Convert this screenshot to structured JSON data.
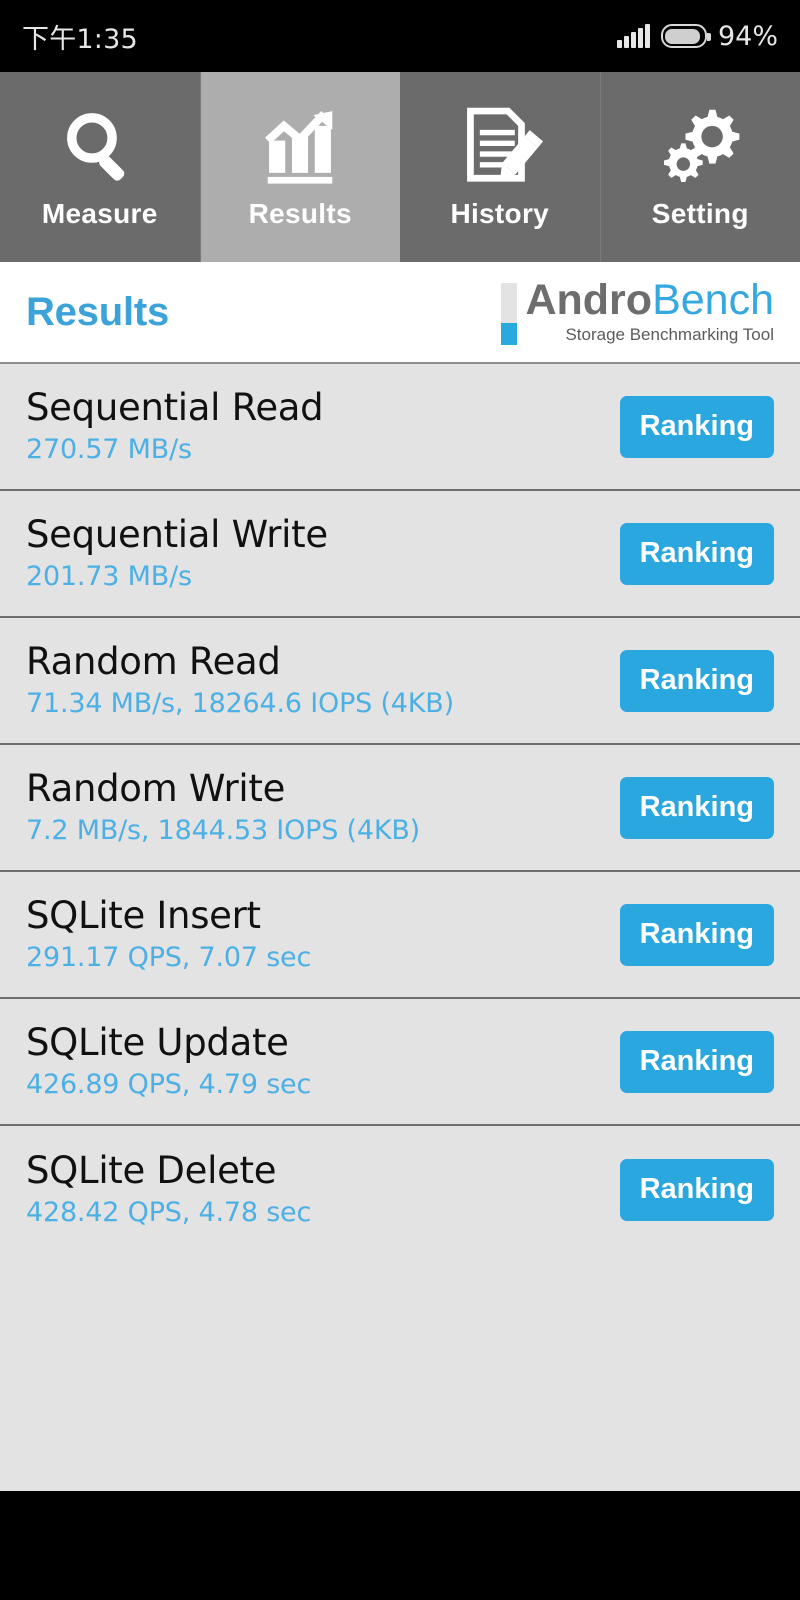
{
  "statusbar": {
    "time": "下午1:35",
    "battery_percent": "94%",
    "signal_icon": "signal-bars-icon",
    "battery_icon": "battery-icon"
  },
  "tabs": [
    {
      "label": "Measure",
      "icon": "magnifier-icon",
      "active": false
    },
    {
      "label": "Results",
      "icon": "bar-chart-arrow-icon",
      "active": true
    },
    {
      "label": "History",
      "icon": "document-pencil-icon",
      "active": false
    },
    {
      "label": "Setting",
      "icon": "gears-icon",
      "active": false
    }
  ],
  "header": {
    "title": "Results",
    "brand_first": "Andro",
    "brand_second": "Bench",
    "tagline": "Storage Benchmarking Tool"
  },
  "results": [
    {
      "title": "Sequential Read",
      "value": "270.57 MB/s",
      "button": "Ranking"
    },
    {
      "title": "Sequential Write",
      "value": "201.73 MB/s",
      "button": "Ranking"
    },
    {
      "title": "Random Read",
      "value": "71.34 MB/s, 18264.6 IOPS (4KB)",
      "button": "Ranking"
    },
    {
      "title": "Random Write",
      "value": "7.2 MB/s, 1844.53 IOPS (4KB)",
      "button": "Ranking"
    },
    {
      "title": "SQLite Insert",
      "value": "291.17 QPS, 7.07 sec",
      "button": "Ranking"
    },
    {
      "title": "SQLite Update",
      "value": "426.89 QPS, 4.79 sec",
      "button": "Ranking"
    },
    {
      "title": "SQLite Delete",
      "value": "428.42 QPS, 4.78 sec",
      "button": "Ranking"
    }
  ],
  "colors": {
    "accent_blue": "#2ba7e0",
    "value_blue": "#4cb0e4",
    "title_blue": "#3ba3d8",
    "list_bg": "#e4e3e4",
    "tab_inactive": "#6b6b6b",
    "tab_active": "#adadad"
  }
}
